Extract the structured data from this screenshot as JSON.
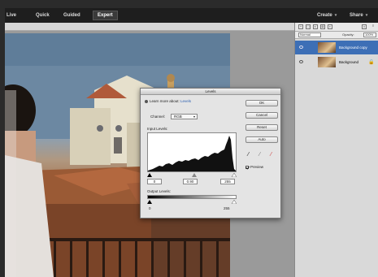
{
  "topbar": {
    "modes": [
      "Live",
      "Quick",
      "Guided",
      "Expert"
    ],
    "active_mode": "Expert",
    "create_label": "Create",
    "share_label": "Share"
  },
  "layers_panel": {
    "blend_mode": "Normal",
    "opacity_label": "Opacity:",
    "opacity_value": "100%",
    "layers": [
      {
        "name": "Background copy",
        "selected": true
      },
      {
        "name": "Background",
        "selected": false
      }
    ]
  },
  "levels_dialog": {
    "title": "Levels",
    "learn_prefix": "Learn more about:",
    "learn_link": "Levels",
    "channel_label": "Channel:",
    "channel_value": "RGB",
    "input_levels_label": "Input Levels:",
    "input_values": [
      "0",
      "0.90",
      "255"
    ],
    "output_levels_label": "Output Levels:",
    "output_values": [
      "0",
      "255"
    ],
    "buttons": {
      "ok": "OK",
      "cancel": "Cancel",
      "reset": "Reset",
      "auto": "Auto"
    },
    "preview_label": "Preview",
    "preview_checked": true
  },
  "colors": {
    "selected_layer": "#3d6fb6",
    "link": "#2a5db0",
    "topbar_bg": "#1e1e1e"
  }
}
